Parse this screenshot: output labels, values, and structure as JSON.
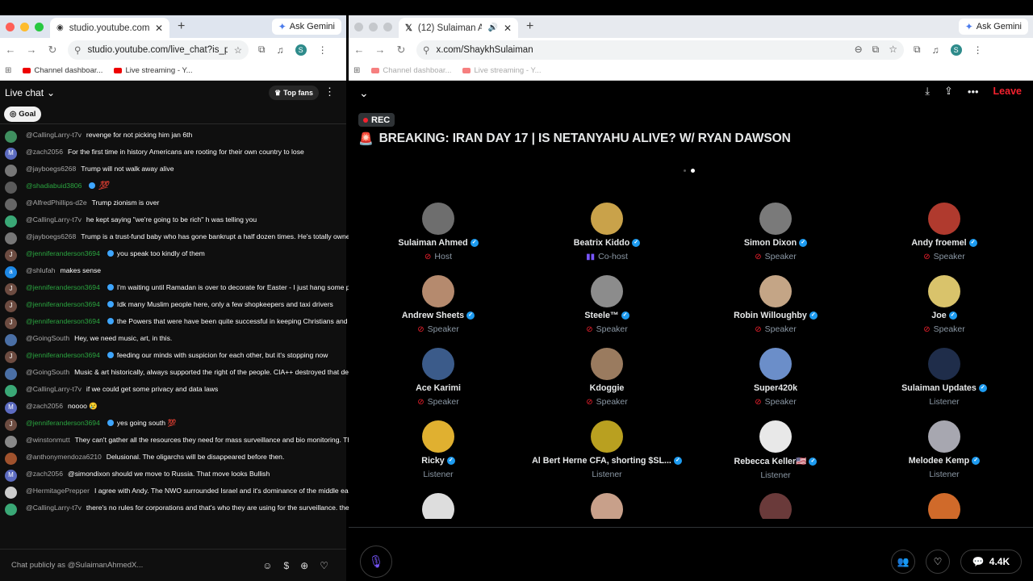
{
  "left_window": {
    "tab_title": "studio.youtube.com/live_chat",
    "url": "studio.youtube.com/live_chat?is_popout...",
    "ask_gemini": "Ask Gemini",
    "bookmarks": [
      "Channel dashboar...",
      "Live streaming - Y..."
    ],
    "profile_letter": "S"
  },
  "chat": {
    "header": "Live chat",
    "top_fans": "Top fans",
    "goal": "Goal",
    "input_placeholder": "Chat publicly as @SulaimanAhmedX...",
    "messages": [
      {
        "author": "@CallingLarry-t7v",
        "text": "revenge for not picking him jan 6th",
        "color": "#3f8f5f",
        "initial": ""
      },
      {
        "author": "@zach2056",
        "text": "For the first time in history Americans are rooting for their own country to lose",
        "color": "#5c6bc0",
        "initial": "M"
      },
      {
        "author": "@jayboegs6268",
        "text": "Trump will not walk away alive",
        "color": "#777777",
        "initial": ""
      },
      {
        "author": "@shadiabuid3806",
        "text": "💯",
        "color": "#5a5a5a",
        "initial": "",
        "green": true,
        "badge": true,
        "red_emoji": true
      },
      {
        "author": "@AlfredPhillips-d2e",
        "text": "Trump zionism is over",
        "color": "#666666",
        "initial": ""
      },
      {
        "author": "@CallingLarry-t7v",
        "text": "he kept saying \"we're going to be rich\" h was telling you",
        "color": "#3aa876",
        "initial": ""
      },
      {
        "author": "@jayboegs6268",
        "text": "Trump is a trust-fund baby who has gone bankrupt a half dozen times. He's totally owned by the real billionaires. He'll be thrown in the trash by his owners very soon.",
        "color": "#777777",
        "initial": ""
      },
      {
        "author": "@jenniferanderson3694",
        "text": "you speak too kindly of them",
        "color": "#6d4c41",
        "initial": "J",
        "green": true,
        "badge": true
      },
      {
        "author": "@shlufah",
        "text": "makes sense",
        "color": "#1e88e5",
        "initial": "a"
      },
      {
        "author": "@jenniferanderson3694",
        "text": "I'm waiting until Ramadan is over to decorate for Easter - I just hang some painted eggs on a little white tree I bought from target last year",
        "color": "#6d4c41",
        "initial": "J",
        "green": true,
        "badge": true
      },
      {
        "author": "@jenniferanderson3694",
        "text": "Idk many Muslim people here, only a few shopkeepers and taxi drivers",
        "color": "#6d4c41",
        "initial": "J",
        "green": true,
        "badge": true
      },
      {
        "author": "@jenniferanderson3694",
        "text": "the Powers that were have been quite successful in keeping Christians and Muslims apart haven't they",
        "color": "#6d4c41",
        "initial": "J",
        "green": true,
        "badge": true
      },
      {
        "author": "@GoingSouth",
        "text": "Hey, we need music, art, in this.",
        "color": "#4a6fa5",
        "initial": ""
      },
      {
        "author": "@jenniferanderson3694",
        "text": "feeding our minds with suspicion for each other, but it's stopping now",
        "color": "#6d4c41",
        "initial": "J",
        "green": true,
        "badge": true
      },
      {
        "author": "@GoingSouth",
        "text": "Music & art historically, always supported the right of the people. CIA++ destroyed that deep connection to the Land and People",
        "color": "#4a6fa5",
        "initial": ""
      },
      {
        "author": "@CallingLarry-t7v",
        "text": "if we could get some privacy and data laws",
        "color": "#3aa876",
        "initial": ""
      },
      {
        "author": "@zach2056",
        "text": "noooo 😢",
        "color": "#5c6bc0",
        "initial": "M"
      },
      {
        "author": "@jenniferanderson3694",
        "text": "yes going south 💯",
        "color": "#6d4c41",
        "initial": "J",
        "green": true,
        "badge": true
      },
      {
        "author": "@winstonmutt",
        "text": "They can't gather all the resources they need for mass surveillance and bio monitoring. Their project is waning, about to expire",
        "color": "#888888",
        "initial": ""
      },
      {
        "author": "@anthonymendoza6210",
        "text": "Delusional. The oligarchs will be disappeared before then.",
        "color": "#a0522d",
        "initial": ""
      },
      {
        "author": "@zach2056",
        "text": "@simondixon should we move to Russia. That move looks Bullish",
        "color": "#5c6bc0",
        "initial": "M"
      },
      {
        "author": "@HermitagePrepper",
        "text": "I agree with Andy. The NWO surrounded Israel and it's dominance of the middle east",
        "color": "#cccccc",
        "initial": ""
      },
      {
        "author": "@CallingLarry-t7v",
        "text": "there's no rules for corporations and that's who they are using for the surveillance. the laws only prevent them from the govt directly doing it.",
        "color": "#3aa876",
        "initial": ""
      }
    ]
  },
  "right_window": {
    "tab_title": "(12) Sulaiman Ahmed (@S",
    "url": "x.com/ShaykhSulaiman",
    "ask_gemini": "Ask Gemini",
    "bookmarks": [
      "Channel dashboar...",
      "Live streaming - Y..."
    ],
    "profile_letter": "S"
  },
  "space": {
    "leave": "Leave",
    "rec": "REC",
    "title": "BREAKING: IRAN DAY 17 | IS NETANYAHU ALIVE? W/ RYAN DAWSON",
    "reply_count": "4.4K",
    "participants": [
      {
        "name": "Sulaiman Ahmed",
        "role": "Host",
        "verified": true,
        "mic": "off",
        "color": "#6e6e6e"
      },
      {
        "name": "Beatrix Kiddo",
        "role": "Co-host",
        "verified": true,
        "mic": "on",
        "color": "#c9a24a"
      },
      {
        "name": "Simon Dixon",
        "role": "Speaker",
        "verified": true,
        "mic": "off",
        "color": "#7a7a7a"
      },
      {
        "name": "Andy froemel",
        "role": "Speaker",
        "verified": true,
        "mic": "off",
        "color": "#b03a2e"
      },
      {
        "name": "Andrew Sheets",
        "role": "Speaker",
        "verified": true,
        "mic": "off",
        "color": "#b58a6e"
      },
      {
        "name": "Steele™",
        "role": "Speaker",
        "verified": true,
        "mic": "off",
        "color": "#8c8c8c"
      },
      {
        "name": "Robin Willoughby",
        "role": "Speaker",
        "verified": true,
        "mic": "off",
        "color": "#c4a586"
      },
      {
        "name": "Joe",
        "role": "Speaker",
        "verified": true,
        "mic": "off",
        "color": "#d9c36b"
      },
      {
        "name": "Ace Karimi",
        "role": "Speaker",
        "verified": false,
        "mic": "off",
        "color": "#3b5b8a"
      },
      {
        "name": "Kdoggie",
        "role": "Speaker",
        "verified": false,
        "mic": "off",
        "color": "#9a7b5f"
      },
      {
        "name": "Super420k",
        "role": "Speaker",
        "verified": false,
        "mic": "off",
        "color": "#6b8ec9"
      },
      {
        "name": "Sulaiman Updates",
        "role": "Listener",
        "verified": true,
        "mic": "none",
        "color": "#1f2d4a"
      },
      {
        "name": "Ricky",
        "role": "Listener",
        "verified": true,
        "mic": "none",
        "color": "#e0b030"
      },
      {
        "name": "Al Bert Herne CFA, shorting $SL...",
        "role": "Listener",
        "verified": true,
        "mic": "none",
        "color": "#b9a020"
      },
      {
        "name": "Rebecca Keller🇺🇸",
        "role": "Listener",
        "verified": true,
        "mic": "none",
        "color": "#e8e8e8"
      },
      {
        "name": "Melodee Kemp",
        "role": "Listener",
        "verified": true,
        "mic": "none",
        "color": "#a7a7b0"
      },
      {
        "name": "",
        "role": "",
        "verified": false,
        "mic": "none",
        "color": "#dddddd"
      },
      {
        "name": "",
        "role": "",
        "verified": false,
        "mic": "none",
        "color": "#c8a08a"
      },
      {
        "name": "",
        "role": "",
        "verified": false,
        "mic": "none",
        "color": "#6a3a3a"
      },
      {
        "name": "",
        "role": "",
        "verified": false,
        "mic": "none",
        "color": "#d06a2a"
      }
    ]
  }
}
